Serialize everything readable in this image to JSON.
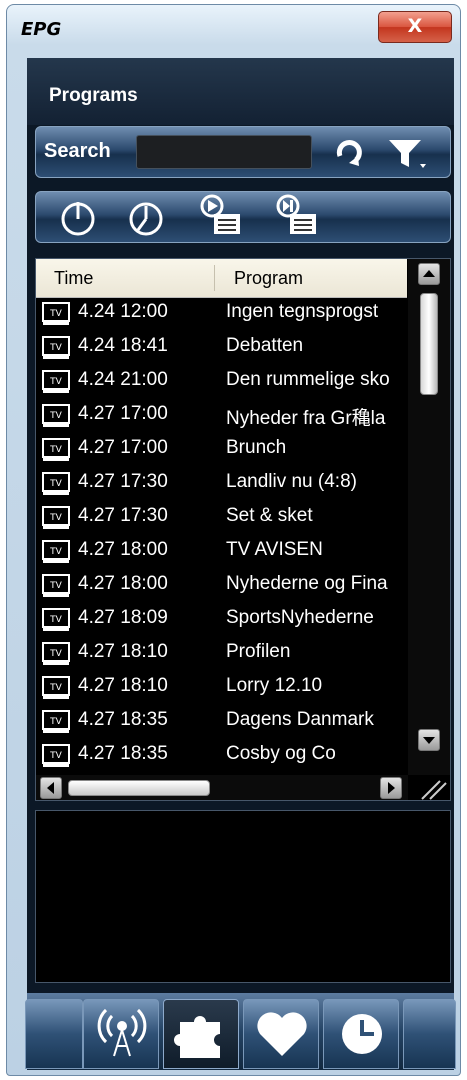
{
  "window": {
    "title": "EPG",
    "close_glyph": "X"
  },
  "panel": {
    "title": "Programs"
  },
  "search": {
    "label": "Search",
    "value": "",
    "placeholder": ""
  },
  "toolbar": {
    "icons": [
      "power-icon",
      "clock-icon",
      "record-play-icon",
      "record-next-icon"
    ]
  },
  "list": {
    "columns": {
      "time": "Time",
      "program": "Program"
    },
    "rows": [
      {
        "time": "4.24 12:00",
        "program": "Ingen tegnsprogst"
      },
      {
        "time": "4.24 18:41",
        "program": "Debatten"
      },
      {
        "time": "4.24 21:00",
        "program": "Den rummelige sko"
      },
      {
        "time": "4.27 17:00",
        "program": "Nyheder fra Gr穐la"
      },
      {
        "time": "4.27 17:00",
        "program": "Brunch"
      },
      {
        "time": "4.27 17:30",
        "program": "Landliv nu (4:8)"
      },
      {
        "time": "4.27 17:30",
        "program": "Set & sket"
      },
      {
        "time": "4.27 18:00",
        "program": "TV AVISEN"
      },
      {
        "time": "4.27 18:00",
        "program": "Nyhederne og Fina"
      },
      {
        "time": "4.27 18:09",
        "program": "SportsNyhederne"
      },
      {
        "time": "4.27 18:10",
        "program": "Profilen"
      },
      {
        "time": "4.27 18:10",
        "program": "Lorry 12.10"
      },
      {
        "time": "4.27 18:35",
        "program": "Dagens Danmark"
      },
      {
        "time": "4.27 18:35",
        "program": "Cosby og Co"
      }
    ],
    "row_icon": "tv-icon",
    "row_icon_label": "TV"
  },
  "tabs": [
    {
      "icon": "broadcast-icon",
      "active": false
    },
    {
      "icon": "puzzle-icon",
      "active": true
    },
    {
      "icon": "heart-icon",
      "active": false
    },
    {
      "icon": "clock-icon",
      "active": false
    }
  ],
  "colors": {
    "row_text": "#ffffff",
    "panel_bg": "#0c1826",
    "accent": "#2d4e74"
  }
}
